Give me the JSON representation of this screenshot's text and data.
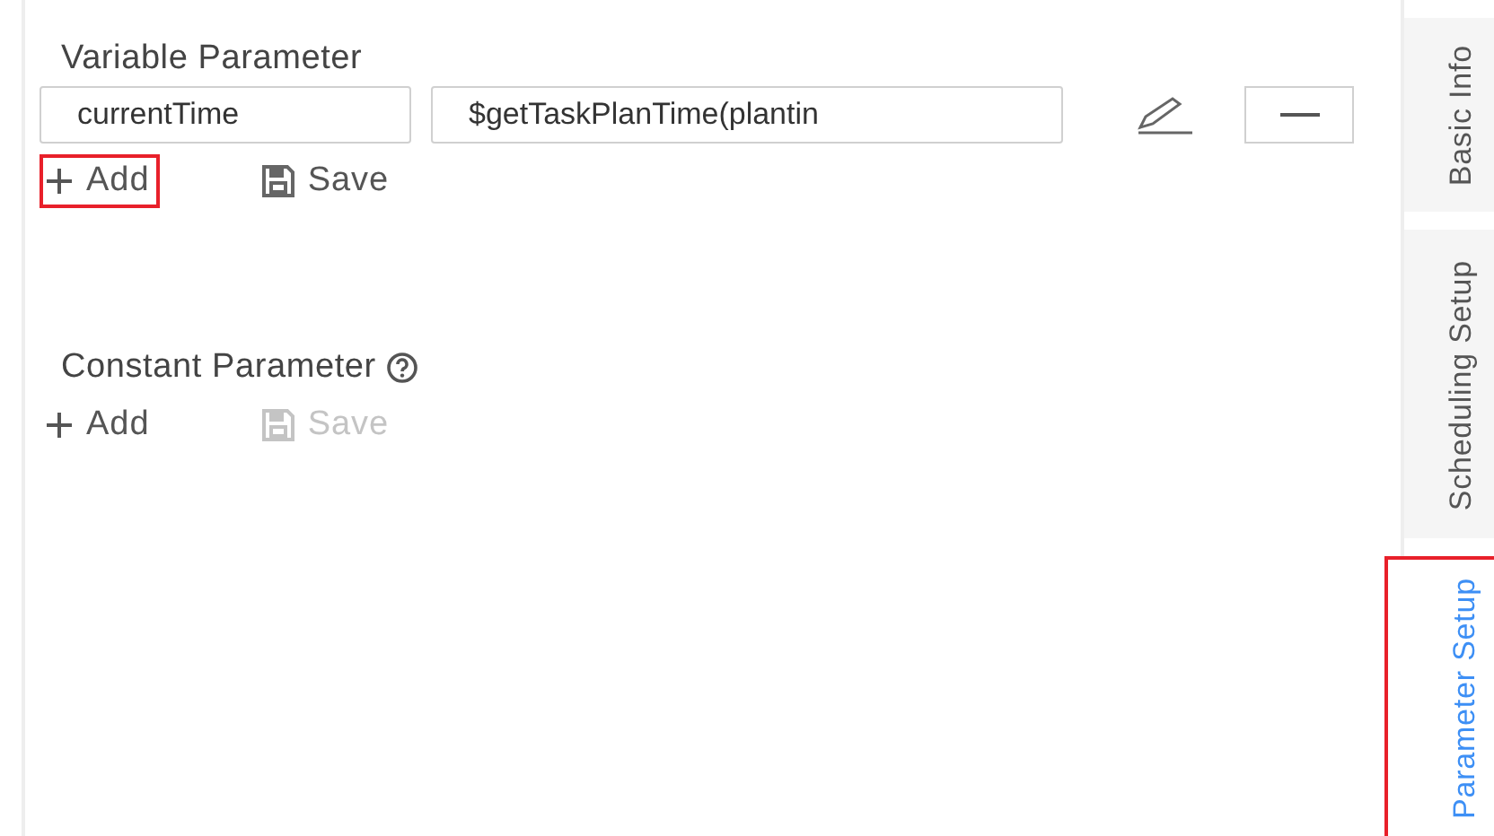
{
  "variable_parameter": {
    "title": "Variable Parameter",
    "rows": [
      {
        "name": "currentTime",
        "value": "$getTaskPlanTime(plantin"
      }
    ],
    "add": {
      "label": "Add",
      "highlighted": true
    },
    "save": {
      "label": "Save",
      "disabled": false
    }
  },
  "constant_parameter": {
    "title": "Constant Parameter",
    "add": {
      "label": "Add",
      "highlighted": false
    },
    "save": {
      "label": "Save",
      "disabled": true
    }
  },
  "tabs": [
    {
      "label": "Basic Info",
      "selected": false,
      "highlighted": false
    },
    {
      "label": "Scheduling Setup",
      "selected": false,
      "highlighted": false
    },
    {
      "label": "Parameter Setup",
      "selected": true,
      "highlighted": true
    }
  ]
}
